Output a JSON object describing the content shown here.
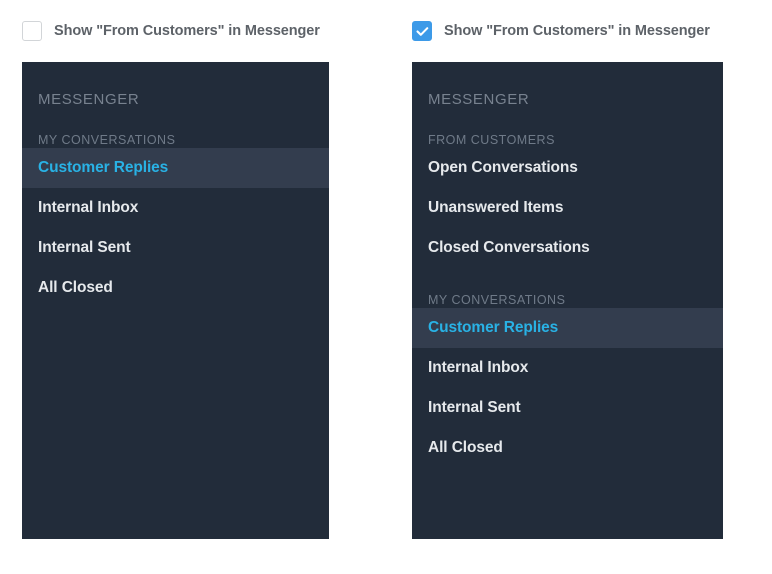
{
  "colors": {
    "panel_bg": "#222c3a",
    "panel_selected_bg": "#333d4e",
    "accent_blue": "#29b2e5",
    "checkbox_checked": "#3d9ae8",
    "nav_text": "#e6e9ec",
    "section_label": "#6f7a88",
    "panel_title": "#78828f",
    "checkbox_label": "#5d6268"
  },
  "variants": [
    {
      "id": "unchecked",
      "checkbox": {
        "label": "Show \"From Customers\" in Messenger",
        "checked": false,
        "icon": "checkmark-icon"
      },
      "panel": {
        "title": "MESSENGER",
        "sections": [
          {
            "label": "MY CONVERSATIONS",
            "items": [
              {
                "label": "Customer Replies",
                "selected": true
              },
              {
                "label": "Internal Inbox",
                "selected": false
              },
              {
                "label": "Internal Sent",
                "selected": false
              },
              {
                "label": "All Closed",
                "selected": false
              }
            ]
          }
        ]
      }
    },
    {
      "id": "checked",
      "checkbox": {
        "label": "Show \"From Customers\" in Messenger",
        "checked": true,
        "icon": "checkmark-icon"
      },
      "panel": {
        "title": "MESSENGER",
        "sections": [
          {
            "label": "FROM CUSTOMERS",
            "items": [
              {
                "label": "Open Conversations",
                "selected": false
              },
              {
                "label": "Unanswered Items",
                "selected": false
              },
              {
                "label": "Closed Conversations",
                "selected": false
              }
            ]
          },
          {
            "label": "MY CONVERSATIONS",
            "items": [
              {
                "label": "Customer Replies",
                "selected": true
              },
              {
                "label": "Internal Inbox",
                "selected": false
              },
              {
                "label": "Internal Sent",
                "selected": false
              },
              {
                "label": "All Closed",
                "selected": false
              }
            ]
          }
        ]
      }
    }
  ]
}
